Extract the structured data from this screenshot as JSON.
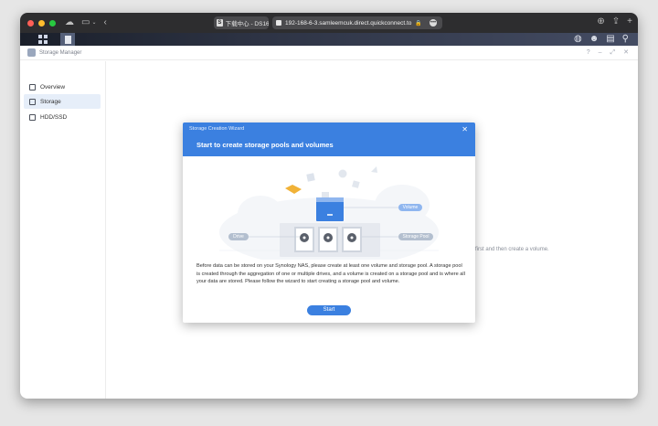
{
  "browser": {
    "tab_badge": "S",
    "tab_title": "下载中心 - DS163...",
    "url": "192-168-6-3.samleemcuk.direct.quickconnect.to"
  },
  "app": {
    "title": "Storage Manager"
  },
  "sidebar": {
    "items": [
      {
        "label": "Overview"
      },
      {
        "label": "Storage"
      },
      {
        "label": "HDD/SSD"
      }
    ]
  },
  "content": {
    "hint": "first and then create a volume."
  },
  "modal": {
    "small_title": "Storage Creation Wizard",
    "title": "Start to create storage pools and volumes",
    "description": "Before data can be stored on your Synology NAS, please create at least one volume and storage pool. A storage pool is created through the aggregation of one or multiple drives, and a volume is created on a storage pool and is where all your data are stored. Please follow the wizard to start creating a storage pool and volume.",
    "start_label": "Start",
    "labels": {
      "volume": "Volume",
      "drive": "Drive",
      "storage_pool": "Storage Pool"
    }
  },
  "colors": {
    "accent": "#3b80e0",
    "titlebar": "#2d2d2f",
    "close": "#ff5f57",
    "minimize": "#febc2e",
    "zoom": "#28c840"
  },
  "icons": {
    "traffic_lights": [
      "close-dot",
      "minimize-dot",
      "zoom-dot"
    ],
    "browser_left": [
      "cloud-icon",
      "sidebar-icon",
      "back-icon"
    ],
    "browser_right": [
      "download-icon",
      "share-icon",
      "new-tab-icon"
    ],
    "taskbar_right": [
      "chat-icon",
      "user-icon",
      "widget-icon",
      "search-icon"
    ]
  }
}
